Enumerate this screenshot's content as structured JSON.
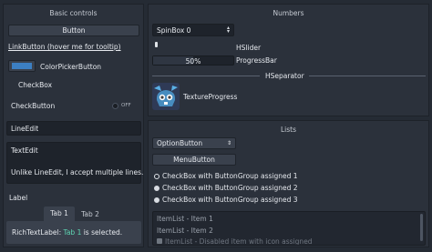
{
  "basic": {
    "title": "Basic controls",
    "button_label": "Button",
    "link_label": "LinkButton (hover me for tooltip)",
    "colorpicker_label": "ColorPickerButton",
    "colorpicker_color": "#3c7fc2",
    "checkbox_label": "CheckBox",
    "checkbutton_label": "CheckButton",
    "checkbutton_state": "OFF",
    "lineedit_text": "LineEdit",
    "textedit_text": "TextEdit",
    "multiline_text": "Unlike LineEdit, I accept multiple lines.",
    "label_text": "Label",
    "tabs": [
      {
        "label": "Tab 1",
        "selected": true
      },
      {
        "label": "Tab 2",
        "selected": false
      }
    ],
    "rich_prefix": "RichTextLabel: ",
    "rich_highlight": "Tab 1",
    "rich_suffix": " is selected.",
    "highlight_color": "#5fd6b3"
  },
  "numbers": {
    "title": "Numbers",
    "spinbox_value": "SpinBox 0",
    "hslider_label": "HSlider",
    "hslider_value": 0,
    "progress_value_text": "50%",
    "progress_fraction": 0.5,
    "progressbar_label": "ProgressBar",
    "hseparator_label": "HSeparator",
    "texture_progress_label": "TextureProgress"
  },
  "lists": {
    "title": "Lists",
    "option_button_label": "OptionButton",
    "menu_button_label": "MenuButton",
    "radio_items": [
      {
        "label": "CheckBox with ButtonGroup assigned 1",
        "checked": false
      },
      {
        "label": "CheckBox with ButtonGroup assigned 2",
        "checked": true
      },
      {
        "label": "CheckBox with ButtonGroup assigned 3",
        "checked": true
      }
    ],
    "item_list": [
      {
        "label": "ItemList - Item 1",
        "disabled": false
      },
      {
        "label": "ItemList - Item 2",
        "disabled": false
      },
      {
        "label": "ItemList - Disabled item with icon assigned",
        "disabled": true
      }
    ]
  }
}
